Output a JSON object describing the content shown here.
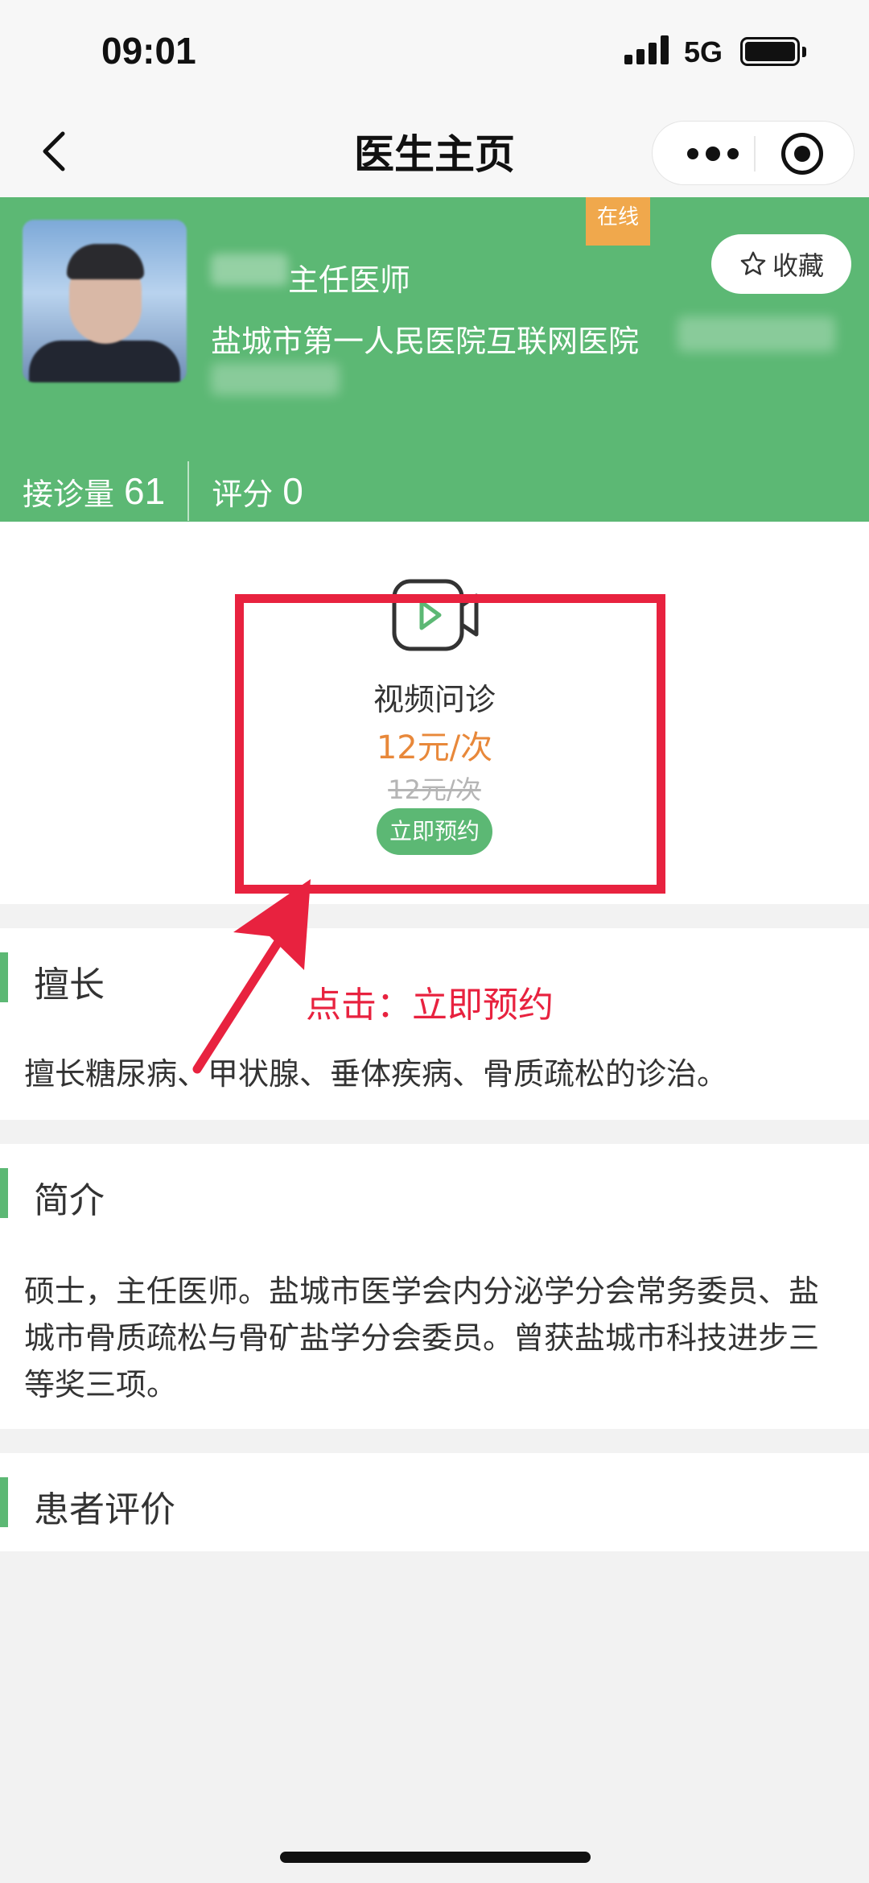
{
  "status_bar": {
    "time": "09:01",
    "network": "5G"
  },
  "nav": {
    "title": "医生主页"
  },
  "doctor": {
    "online_badge": "在线",
    "favorite_label": "收藏",
    "title": "主任医师",
    "hospital": "盐城市第一人民医院互联网医院",
    "stats": [
      {
        "label": "接诊量",
        "value": "61"
      },
      {
        "label": "评分",
        "value": "0"
      }
    ]
  },
  "service": {
    "name": "视频问诊",
    "price": "12元/次",
    "original_price": "12元/次",
    "book_label": "立即预约"
  },
  "annotation": {
    "text": "点击：立即预约",
    "color": "#e8223f"
  },
  "sections": {
    "specialty": {
      "title": "擅长",
      "text": "擅长糖尿病、甲状腺、垂体疾病、骨质疏松的诊治。"
    },
    "intro": {
      "title": "简介",
      "text": "硕士，主任医师。盐城市医学会内分泌学分会常务委员、盐城市骨质疏松与骨矿盐学分会委员。曾获盐城市科技进步三等奖三项。"
    },
    "reviews": {
      "title": "患者评价"
    }
  },
  "colors": {
    "brand_green": "#5cb874",
    "price_orange": "#e8883a",
    "badge_orange": "#f0a84c"
  }
}
